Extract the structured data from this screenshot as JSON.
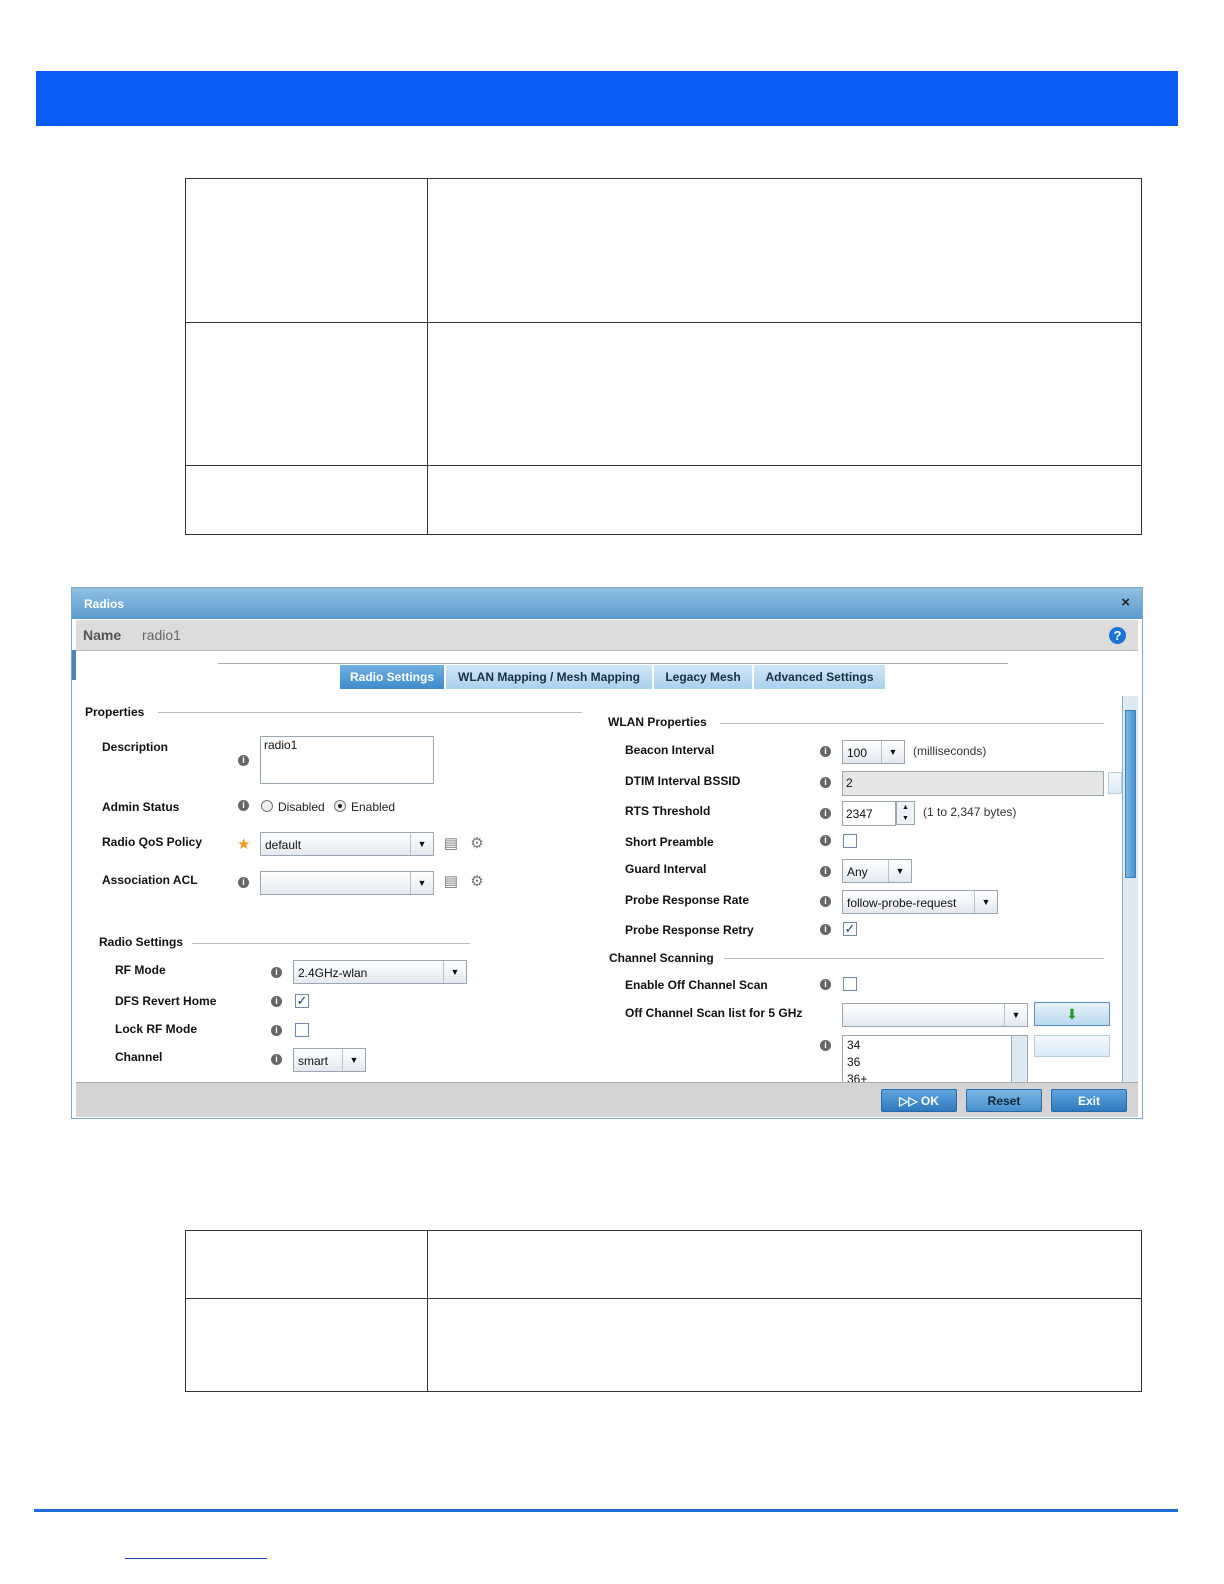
{
  "dialog": {
    "title": "Radios",
    "close_glyph": "×",
    "name_label": "Name",
    "name_value": "radio1",
    "help_glyph": "?",
    "tabs": [
      {
        "label": "Radio Settings",
        "active": true
      },
      {
        "label": "WLAN Mapping / Mesh Mapping",
        "active": false
      },
      {
        "label": "Legacy Mesh",
        "active": false
      },
      {
        "label": "Advanced Settings",
        "active": false
      }
    ],
    "properties": {
      "title": "Properties",
      "description_label": "Description",
      "description_value": "radio1",
      "admin_status_label": "Admin Status",
      "admin_disabled": "Disabled",
      "admin_enabled": "Enabled",
      "admin_selected": "Enabled",
      "qos_label": "Radio QoS Policy",
      "qos_value": "default",
      "acl_label": "Association ACL",
      "acl_value": ""
    },
    "radio_settings": {
      "title": "Radio Settings",
      "rf_mode_label": "RF Mode",
      "rf_mode_value": "2.4GHz-wlan",
      "dfs_label": "DFS Revert Home",
      "dfs_checked": true,
      "lock_label": "Lock RF Mode",
      "lock_checked": false,
      "channel_label": "Channel",
      "channel_value": "smart"
    },
    "wlan_properties": {
      "title": "WLAN Properties",
      "beacon_label": "Beacon Interval",
      "beacon_value": "100",
      "beacon_unit": "(milliseconds)",
      "dtim_label": "DTIM Interval BSSID",
      "dtim_value": "2",
      "rts_label": "RTS Threshold",
      "rts_value": "2347",
      "rts_range": "(1 to 2,347 bytes)",
      "short_preamble_label": "Short Preamble",
      "short_preamble_checked": false,
      "guard_label": "Guard Interval",
      "guard_value": "Any",
      "probe_rate_label": "Probe Response Rate",
      "probe_rate_value": "follow-probe-request",
      "probe_retry_label": "Probe Response Retry",
      "probe_retry_checked": true
    },
    "channel_scanning": {
      "title": "Channel Scanning",
      "enable_label": "Enable Off Channel Scan",
      "enable_checked": false,
      "list_label": "Off Channel Scan list for 5 GHz",
      "list_items": [
        "34",
        "36",
        "36+"
      ]
    },
    "buttons": {
      "ok": "OK",
      "reset": "Reset",
      "exit": "Exit"
    },
    "icons": {
      "info": "i",
      "star": "★",
      "check": "✓",
      "arrow_down": "▼",
      "arrow_up": "▲",
      "add": "add-policy-icon",
      "settings": "gear-icon"
    }
  },
  "colors": {
    "header_bar": "#0a5cf5",
    "footer_line": "#1f6bd6",
    "tab_active": "#3d8ccb"
  }
}
